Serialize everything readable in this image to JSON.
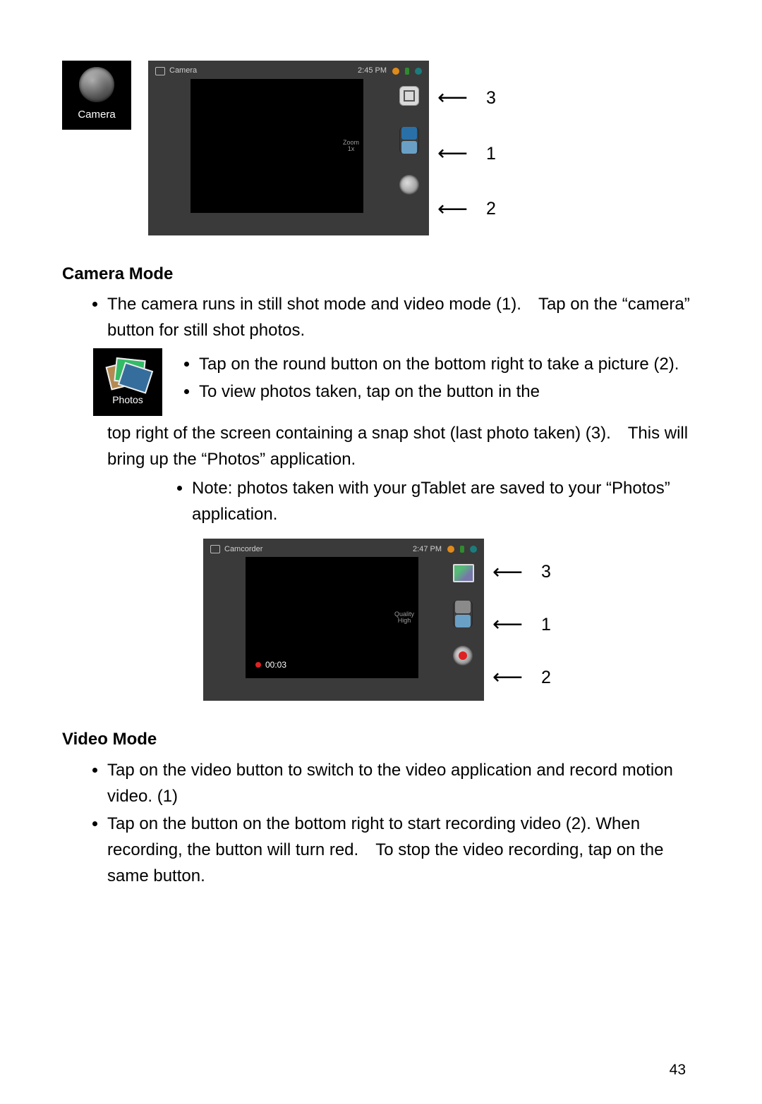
{
  "icons": {
    "camera_label": "Camera",
    "photos_label": "Photos"
  },
  "shot1": {
    "app_title": "Camera",
    "clock": "2:45 PM",
    "vf_label_line1": "Zoom",
    "vf_label_line2": "1x",
    "callout_top": "3",
    "callout_mid": "1",
    "callout_bot": "2"
  },
  "shot2": {
    "app_title": "Camcorder",
    "clock": "2:47 PM",
    "vf_label_line1": "Quality",
    "vf_label_line2": "High",
    "rec_time": "00:03",
    "callout_top": "3",
    "callout_mid": "1",
    "callout_bot": "2"
  },
  "headings": {
    "camera_mode": "Camera Mode",
    "video_mode": "Video Mode"
  },
  "camera_section": {
    "intro": "The camera runs in still shot mode and video mode (1). Tap on the “camera” button for still shot photos.",
    "pt_a": "Tap on the round button on the bottom right to take a picture (2).",
    "pt_b_prefix": "To view photos taken, tap on the button in the",
    "pt_b_suffix": "top right of the screen containing a snap shot (last photo taken) (3). This will bring up the “Photos” application.",
    "note": "Note: photos taken with your gTablet are saved to your “Photos” application."
  },
  "video_section": {
    "pt_a": "Tap on the video button to switch to the video application and record motion video. (1)",
    "pt_b": "Tap on the button on the bottom right to start recording video (2). When recording, the button will turn red. To stop the video recording, tap on the same button."
  },
  "page_number": "43"
}
